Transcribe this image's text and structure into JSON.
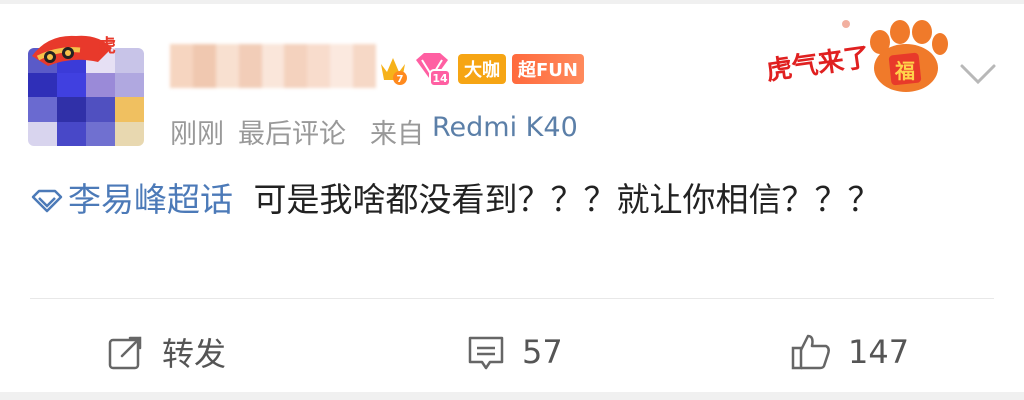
{
  "meta": {
    "time": "刚刚",
    "last_comment": "最后评论",
    "source_prefix": "来自",
    "device": "Redmi K40"
  },
  "badges": {
    "level_number": "14",
    "vip_level": "7",
    "daka": "大咖",
    "fun": "超FUN",
    "tiger_hat_text": "虎",
    "tiger_badge_text": "虎气来了",
    "fu": "福"
  },
  "post": {
    "topic": "李易峰超话",
    "text": "可是我啥都没看到？？？就让你相信？？？"
  },
  "actions": {
    "repost_label": "转发",
    "comment_count": "57",
    "like_count": "147"
  },
  "colors": {
    "link": "#4c7ab8",
    "meta": "#999999",
    "daka": "#f6a514",
    "fun": "#ff6a3d"
  }
}
